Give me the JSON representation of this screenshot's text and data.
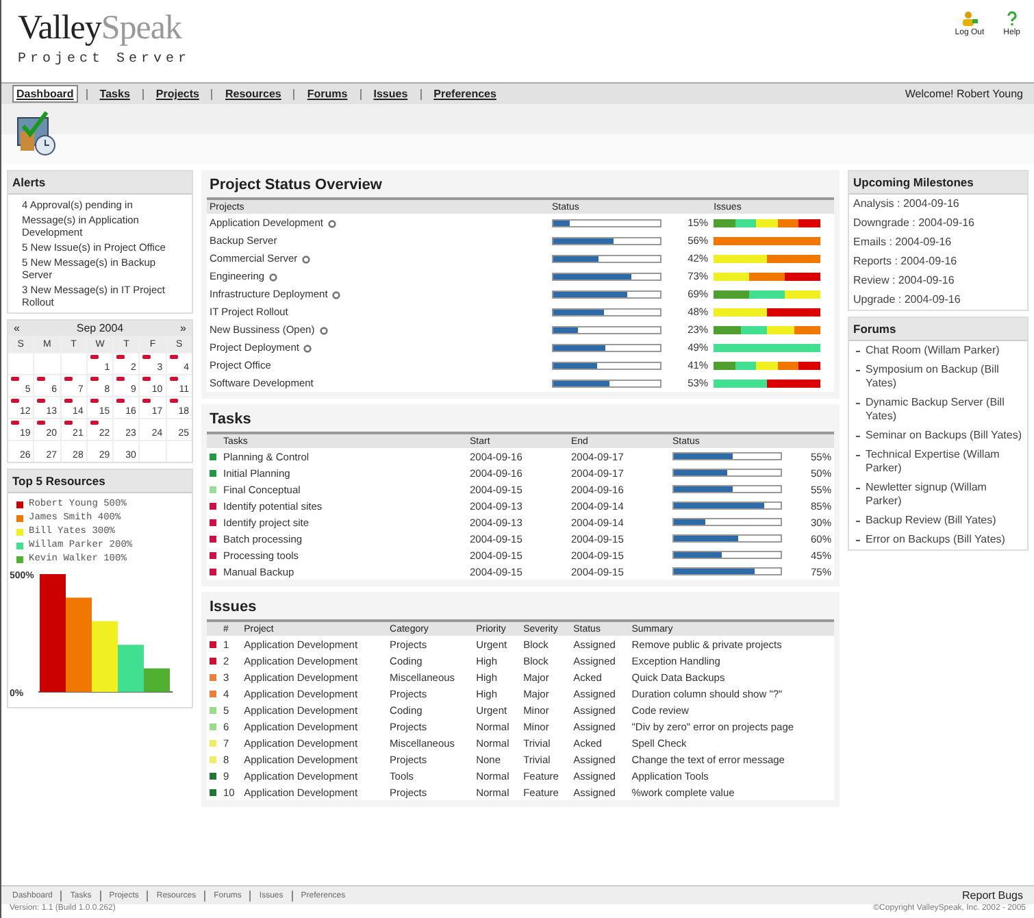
{
  "header": {
    "logo": {
      "first": "Valley",
      "second": "Speak"
    },
    "subtitle": "Project Server",
    "actions": [
      {
        "kind": "logout",
        "label": "Log Out"
      },
      {
        "kind": "help",
        "label": "Help"
      }
    ]
  },
  "nav": {
    "items": [
      {
        "label": "Dashboard",
        "selected": true
      },
      {
        "label": "Tasks",
        "selected": false
      },
      {
        "label": "Projects",
        "selected": false
      },
      {
        "label": "Resources",
        "selected": false
      },
      {
        "label": "Forums",
        "selected": false
      },
      {
        "label": "Issues",
        "selected": false
      },
      {
        "label": "Preferences",
        "selected": false
      }
    ],
    "welcome": "Welcome! Robert Young"
  },
  "alerts": {
    "title": "Alerts",
    "items": [
      "4 Approval(s) pending in",
      "Message(s) in Application Development",
      "5 New Issue(s) in Project Office",
      "5 New Message(s) in Backup Server",
      "3 New Message(s) in IT Project Rollout"
    ]
  },
  "calendar": {
    "prev": "«",
    "month": "Sep 2004",
    "next": "»",
    "weekdays": [
      "S",
      "M",
      "T",
      "W",
      "T",
      "F",
      "S"
    ],
    "weeks": [
      [
        {
          "day": "1",
          "marked": true
        },
        {
          "day": "2",
          "marked": true
        },
        {
          "day": "3",
          "marked": true
        },
        {
          "day": "4",
          "marked": true
        }
      ],
      [
        {
          "day": "5",
          "marked": true
        },
        {
          "day": "6",
          "marked": true
        },
        {
          "day": "7",
          "marked": true
        },
        {
          "day": "8",
          "marked": true
        },
        {
          "day": "9",
          "marked": true
        },
        {
          "day": "10",
          "marked": true
        },
        {
          "day": "11",
          "marked": true
        }
      ],
      [
        {
          "day": "12",
          "marked": true
        },
        {
          "day": "13",
          "marked": true
        },
        {
          "day": "14",
          "marked": true
        },
        {
          "day": "15",
          "marked": true
        },
        {
          "day": "16",
          "marked": true
        },
        {
          "day": "17",
          "marked": true
        },
        {
          "day": "18",
          "marked": true
        }
      ],
      [
        {
          "day": "19",
          "marked": true
        },
        {
          "day": "20",
          "marked": true
        },
        {
          "day": "21",
          "marked": true
        },
        {
          "day": "22",
          "marked": true
        },
        {
          "day": "23",
          "marked": false
        },
        {
          "day": "24",
          "marked": false
        },
        {
          "day": "25",
          "marked": false
        }
      ],
      [
        {
          "day": "26",
          "marked": false
        },
        {
          "day": "27",
          "marked": false
        },
        {
          "day": "28",
          "marked": false
        },
        {
          "day": "29",
          "marked": false
        },
        {
          "day": "30",
          "marked": false
        }
      ]
    ]
  },
  "resources": {
    "title": "Top 5 Resources",
    "legend": [
      {
        "label": "Robert Young 500%",
        "color": "#cc0000"
      },
      {
        "label": "James Smith 400%",
        "color": "#f07800"
      },
      {
        "label": "Bill Yates 300%",
        "color": "#f0f020"
      },
      {
        "label": "Willam Parker 200%",
        "color": "#40e090"
      },
      {
        "label": "Kevin Walker 100%",
        "color": "#50b030"
      }
    ],
    "chart_data": {
      "type": "bar",
      "values": [
        500,
        400,
        300,
        200,
        100
      ],
      "ylim": [
        0,
        500
      ],
      "yticks": [
        {
          "value": 0,
          "label": "0%"
        },
        {
          "value": 500,
          "label": "500%"
        }
      ]
    }
  },
  "overview": {
    "title": "Project Status Overview",
    "columns": [
      "Projects",
      "Status",
      "Issues"
    ],
    "rows": [
      {
        "name": "Application Development",
        "flagged": true,
        "level": 0.15,
        "pct": "15%",
        "issues": [
          {
            "color": "#50a030"
          },
          {
            "color": "#40e090"
          },
          {
            "color": "#f0f020"
          },
          {
            "color": "#f07800"
          },
          {
            "color": "#dd0000"
          }
        ]
      },
      {
        "name": "Backup Server",
        "flagged": false,
        "level": 0.56,
        "pct": "56%",
        "issues": [
          {
            "color": "#f07800"
          }
        ]
      },
      {
        "name": "Commercial Server",
        "flagged": true,
        "level": 0.42,
        "pct": "42%",
        "issues": [
          {
            "color": "#f0f020"
          },
          {
            "color": "#f07800"
          }
        ]
      },
      {
        "name": "Engineering",
        "flagged": true,
        "level": 0.73,
        "pct": "73%",
        "issues": [
          {
            "color": "#f0f020"
          },
          {
            "color": "#f07800"
          },
          {
            "color": "#dd0000"
          }
        ]
      },
      {
        "name": "Infrastructure Deployment",
        "flagged": true,
        "level": 0.69,
        "pct": "69%",
        "issues": [
          {
            "color": "#50a030"
          },
          {
            "color": "#40e090"
          },
          {
            "color": "#f0f020"
          }
        ]
      },
      {
        "name": "IT Project Rollout",
        "flagged": false,
        "level": 0.48,
        "pct": "48%",
        "issues": [
          {
            "color": "#f0f020"
          },
          {
            "color": "#dd0000"
          }
        ]
      },
      {
        "name": "New Bussiness (Open)",
        "flagged": true,
        "level": 0.23,
        "pct": "23%",
        "issues": [
          {
            "color": "#50a030"
          },
          {
            "color": "#40e090"
          },
          {
            "color": "#f0f020"
          },
          {
            "color": "#f07800"
          }
        ]
      },
      {
        "name": "Project Deployment",
        "flagged": true,
        "level": 0.49,
        "pct": "49%",
        "issues": [
          {
            "color": "#40e090"
          }
        ]
      },
      {
        "name": "Project Office",
        "flagged": false,
        "level": 0.41,
        "pct": "41%",
        "issues": [
          {
            "color": "#50a030"
          },
          {
            "color": "#40e090"
          },
          {
            "color": "#f0f020"
          },
          {
            "color": "#f07800"
          },
          {
            "color": "#dd0000"
          }
        ]
      },
      {
        "name": "Software Development",
        "flagged": false,
        "level": 0.53,
        "pct": "53%",
        "issues": [
          {
            "color": "#40e090"
          },
          {
            "color": "#dd0000"
          }
        ]
      }
    ]
  },
  "tasks": {
    "title": "Tasks",
    "columns": [
      "Tasks",
      "Start",
      "End",
      "Status"
    ],
    "rows": [
      {
        "color": "#229944",
        "name": "Planning & Control",
        "start": "2004-09-16",
        "end": "2004-09-17",
        "level": 0.55,
        "pct": "55%"
      },
      {
        "color": "#229944",
        "name": "Initial Planning",
        "start": "2004-09-16",
        "end": "2004-09-17",
        "level": 0.5,
        "pct": "50%"
      },
      {
        "color": "#99dd99",
        "name": "Final Conceptual",
        "start": "2004-09-15",
        "end": "2004-09-16",
        "level": 0.55,
        "pct": "55%"
      },
      {
        "color": "#cc1144",
        "name": "Identify potential sites",
        "start": "2004-09-13",
        "end": "2004-09-14",
        "level": 0.85,
        "pct": "85%"
      },
      {
        "color": "#cc1144",
        "name": "Identify project site",
        "start": "2004-09-13",
        "end": "2004-09-14",
        "level": 0.3,
        "pct": "30%"
      },
      {
        "color": "#cc1144",
        "name": "Batch processing",
        "start": "2004-09-15",
        "end": "2004-09-15",
        "level": 0.6,
        "pct": "60%"
      },
      {
        "color": "#cc1144",
        "name": "Processing tools",
        "start": "2004-09-15",
        "end": "2004-09-15",
        "level": 0.45,
        "pct": "45%"
      },
      {
        "color": "#cc1144",
        "name": "Manual Backup",
        "start": "2004-09-15",
        "end": "2004-09-15",
        "level": 0.75,
        "pct": "75%"
      }
    ]
  },
  "issues": {
    "title": "Issues",
    "columns": [
      "#",
      "Project",
      "Category",
      "Priority",
      "Severity",
      "Status",
      "Summary"
    ],
    "rows": [
      {
        "color": "#cc1133",
        "cells": [
          "1",
          "Application Development",
          "Projects",
          "Urgent",
          "Block",
          "Assigned",
          "Remove public & private projects"
        ]
      },
      {
        "color": "#cc1133",
        "cells": [
          "2",
          "Application Development",
          "Coding",
          "High",
          "Block",
          "Assigned",
          "Exception Handling"
        ]
      },
      {
        "color": "#e8803a",
        "cells": [
          "3",
          "Application Development",
          "Miscellaneous",
          "High",
          "Major",
          "Acked",
          "Quick Data Backups"
        ]
      },
      {
        "color": "#e8803a",
        "cells": [
          "4",
          "Application Development",
          "Projects",
          "High",
          "Major",
          "Assigned",
          "Duration column should show \"?\""
        ]
      },
      {
        "color": "#99dd88",
        "cells": [
          "5",
          "Application Development",
          "Coding",
          "Urgent",
          "Minor",
          "Assigned",
          "Code review"
        ]
      },
      {
        "color": "#99dd88",
        "cells": [
          "6",
          "Application Development",
          "Projects",
          "Normal",
          "Minor",
          "Assigned",
          "\"Div by zero\" error on projects page"
        ]
      },
      {
        "color": "#eeee66",
        "cells": [
          "7",
          "Application Development",
          "Miscellaneous",
          "Normal",
          "Trivial",
          "Acked",
          "Spell Check"
        ]
      },
      {
        "color": "#eeee66",
        "cells": [
          "8",
          "Application Development",
          "Projects",
          "None",
          "Trivial",
          "Assigned",
          "Change the text of error message"
        ]
      },
      {
        "color": "#227733",
        "cells": [
          "9",
          "Application Development",
          "Tools",
          "Normal",
          "Feature",
          "Assigned",
          "Application Tools"
        ]
      },
      {
        "color": "#227733",
        "cells": [
          "10",
          "Application Development",
          "Projects",
          "Normal",
          "Feature",
          "Assigned",
          "%work complete value"
        ]
      }
    ]
  },
  "milestones": {
    "title": "Upcoming Milestones",
    "items": [
      "Analysis : 2004-09-16",
      "Downgrade : 2004-09-16",
      "Emails : 2004-09-16",
      "Reports : 2004-09-16",
      "Review : 2004-09-16",
      "Upgrade : 2004-09-16"
    ]
  },
  "forums": {
    "title": "Forums",
    "items": [
      "Chat Room (Willam Parker)",
      "Symposium on Backup (Bill Yates)",
      "Dynamic Backup Server (Bill Yates)",
      "Seminar on Backups (Bill Yates)",
      "Technical Expertise (Willam Parker)",
      "Newletter signup (Willam Parker)",
      "Backup Review (Bill Yates)",
      "Error on Backups (Bill Yates)"
    ]
  },
  "footer": {
    "links": [
      "Dashboard",
      "Tasks",
      "Projects",
      "Resources",
      "Forums",
      "Issues",
      "Preferences"
    ],
    "report": "Report Bugs",
    "version": "Version: 1.1 (Build 1.0.0.262)",
    "copyright": "©Copyright ValleySpeak, Inc. 2002 - 2005"
  }
}
